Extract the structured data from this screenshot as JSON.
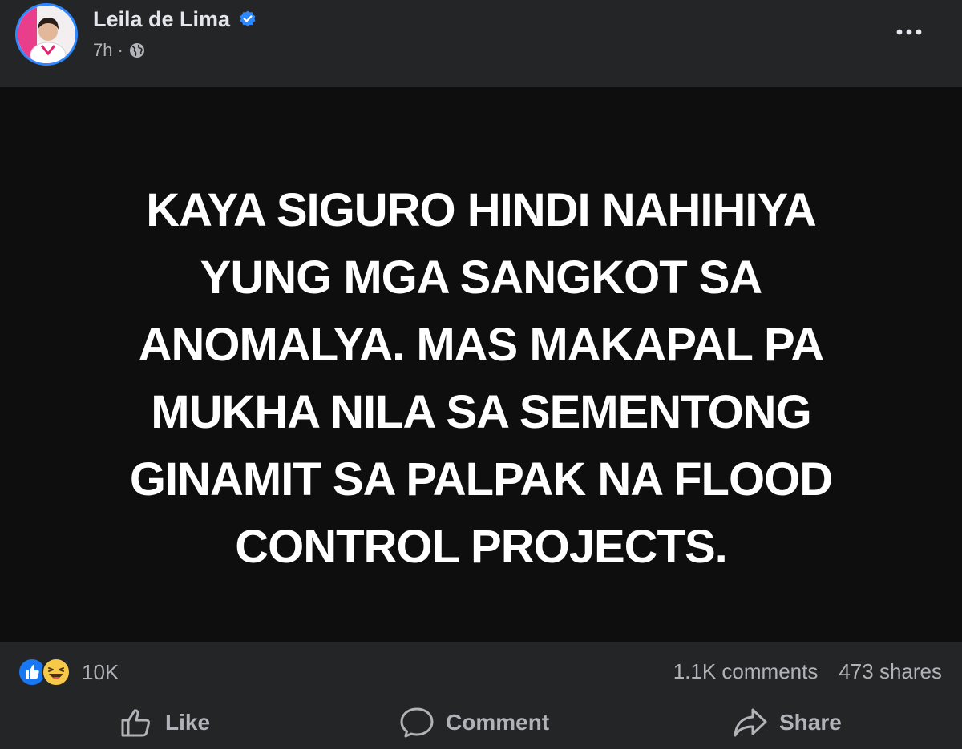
{
  "author": {
    "name": "Leila de Lima",
    "time": "7h",
    "separator": "·"
  },
  "post": {
    "lines": [
      "KAYA SIGURO HINDI NAHIHIYA",
      "YUNG MGA SANGKOT SA",
      "ANOMALYA. MAS MAKAPAL PA",
      "MUKHA NILA SA SEMENTONG",
      "GINAMIT SA PALPAK NA FLOOD",
      "CONTROL PROJECTS."
    ],
    "background_color": "#0e0e0e",
    "text_color": "#ffffff"
  },
  "stats": {
    "reaction_count": "10K",
    "reaction_icons": [
      "like-icon",
      "haha-icon"
    ],
    "comments": "1.1K comments",
    "shares": "473 shares"
  },
  "actions": {
    "like_label": "Like",
    "comment_label": "Comment",
    "share_label": "Share"
  },
  "icons": {
    "verified": "verified-badge-icon",
    "audience": "globe-icon",
    "more": "more-options-icon"
  },
  "colors": {
    "card_bg": "#242526",
    "primary_text": "#e4e6eb",
    "secondary_text": "#b0b3b8",
    "accent_blue": "#2d88ff"
  }
}
